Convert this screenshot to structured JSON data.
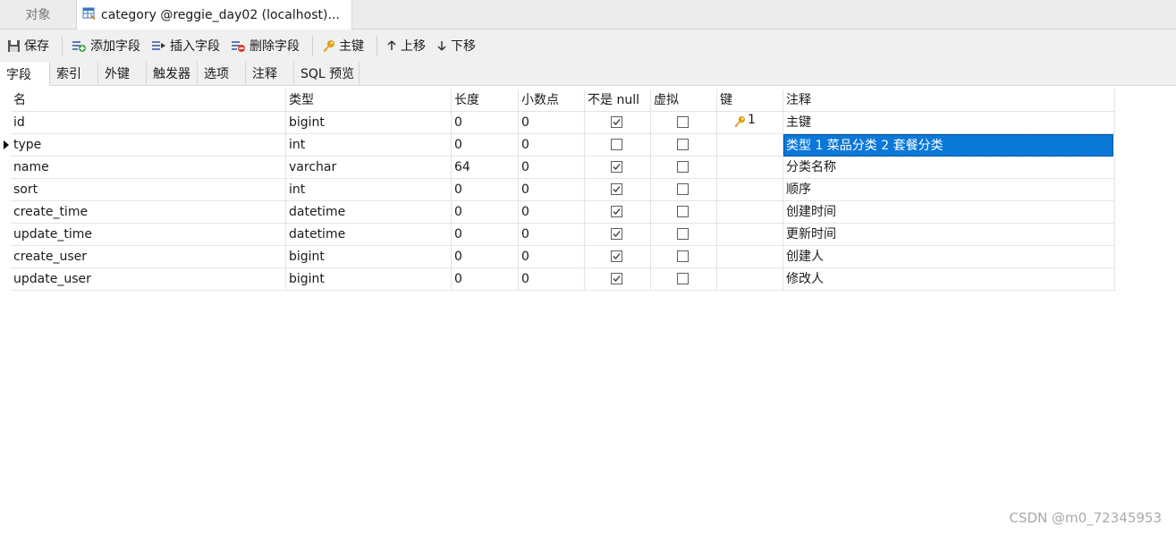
{
  "window_tabs": {
    "objects": "对象",
    "active": "category @reggie_day02 (localhost)..."
  },
  "toolbar": {
    "save": "保存",
    "add_field": "添加字段",
    "insert_field": "插入字段",
    "delete_field": "删除字段",
    "primary_key": "主键",
    "move_up": "上移",
    "move_down": "下移"
  },
  "subtabs": [
    "字段",
    "索引",
    "外键",
    "触发器",
    "选项",
    "注释",
    "SQL 预览"
  ],
  "columns": [
    "名",
    "类型",
    "长度",
    "小数点",
    "不是 null",
    "虚拟",
    "键",
    "注释"
  ],
  "fields": [
    {
      "name": "id",
      "type": "bigint",
      "length": "0",
      "decimals": "0",
      "not_null": true,
      "virtual": false,
      "key": "1",
      "comment": "主键"
    },
    {
      "name": "type",
      "type": "int",
      "length": "0",
      "decimals": "0",
      "not_null": false,
      "virtual": false,
      "key": "",
      "comment": "类型   1 菜品分类 2 套餐分类"
    },
    {
      "name": "name",
      "type": "varchar",
      "length": "64",
      "decimals": "0",
      "not_null": true,
      "virtual": false,
      "key": "",
      "comment": "分类名称"
    },
    {
      "name": "sort",
      "type": "int",
      "length": "0",
      "decimals": "0",
      "not_null": true,
      "virtual": false,
      "key": "",
      "comment": "顺序"
    },
    {
      "name": "create_time",
      "type": "datetime",
      "length": "0",
      "decimals": "0",
      "not_null": true,
      "virtual": false,
      "key": "",
      "comment": "创建时间"
    },
    {
      "name": "update_time",
      "type": "datetime",
      "length": "0",
      "decimals": "0",
      "not_null": true,
      "virtual": false,
      "key": "",
      "comment": "更新时间"
    },
    {
      "name": "create_user",
      "type": "bigint",
      "length": "0",
      "decimals": "0",
      "not_null": true,
      "virtual": false,
      "key": "",
      "comment": "创建人"
    },
    {
      "name": "update_user",
      "type": "bigint",
      "length": "0",
      "decimals": "0",
      "not_null": true,
      "virtual": false,
      "key": "",
      "comment": "修改人"
    }
  ],
  "current_row": 1,
  "watermark": "CSDN @m0_72345953",
  "colors": {
    "selection": "#0a78d7",
    "key_icon": "#e0a21b"
  }
}
